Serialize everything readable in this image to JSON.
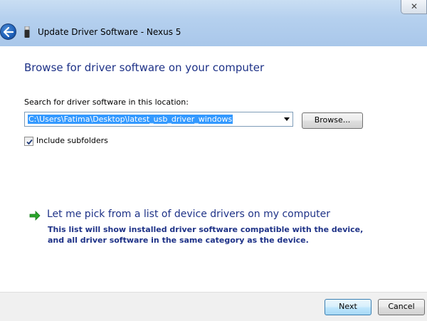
{
  "window": {
    "title": "Update Driver Software - Nexus 5",
    "close_glyph": "✕"
  },
  "main": {
    "heading": "Browse for driver software on your computer",
    "location_label": "Search for driver software in this location:",
    "path_value": "C:\\Users\\Fatima\\Desktop\\latest_usb_driver_windows",
    "browse_label": "Browse...",
    "include_subfolders_label": "Include subfolders",
    "include_subfolders_checked": true,
    "pick_link": "Let me pick from a list of device drivers on my computer",
    "pick_description": "This list will show installed driver software compatible with the device, and all driver software in the same category as the device."
  },
  "footer": {
    "next_label": "Next",
    "cancel_label": "Cancel"
  },
  "colors": {
    "heading": "#1e3287",
    "selection": "#3399ff",
    "arrow_green": "#2aa52a"
  }
}
